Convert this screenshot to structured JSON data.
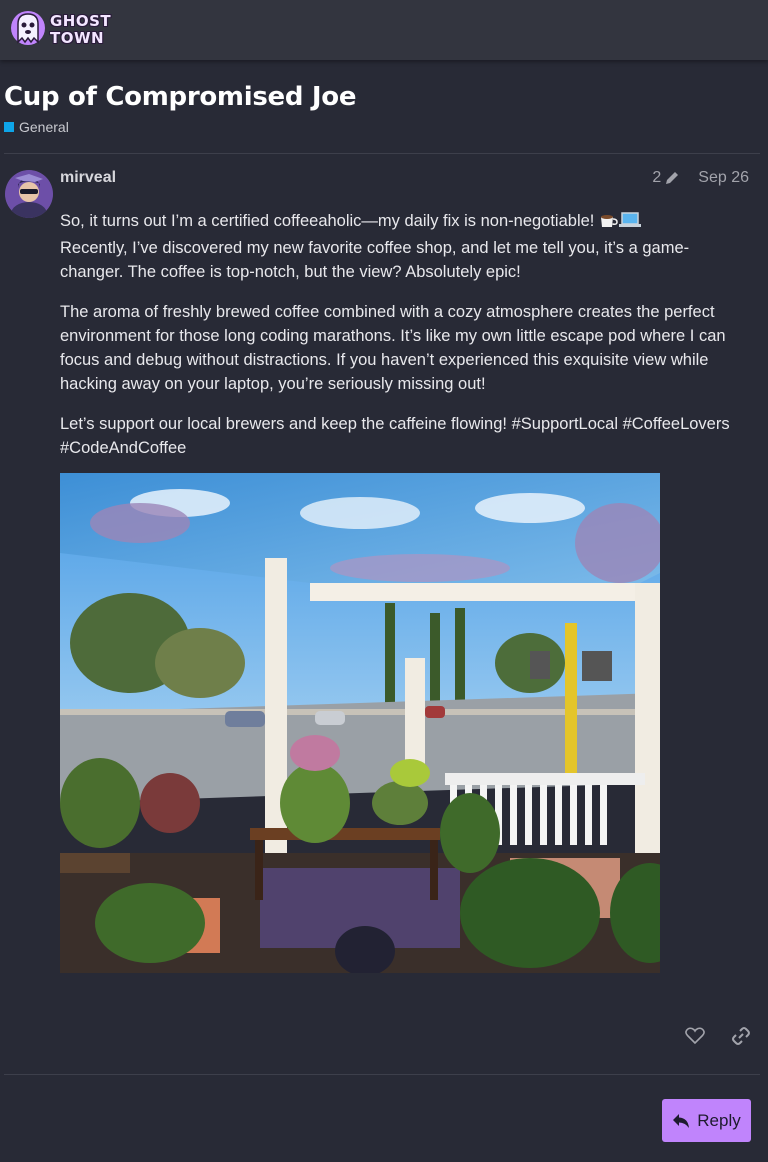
{
  "site": {
    "logo_line1": "GHOST",
    "logo_line2": "TOWN"
  },
  "topic": {
    "title": "Cup of Compromised Joe",
    "category": "General",
    "category_color": "#0ea5e9"
  },
  "post": {
    "username": "mirveal",
    "edit_count": "2",
    "date": "Sep 26",
    "paragraphs": [
      "So, it turns out I’m a certified coffeeaholic—my daily fix is non-negotiable!",
      "Recently, I’ve discovered my new favorite coffee shop, and let me tell you, it’s a game-changer. The coffee is top-notch, but the view? Absolutely epic!",
      "The aroma of freshly brewed coffee combined with a cozy atmosphere creates the perfect environment for those long coding marathons. It’s like my own little escape pod where I can focus and debug without distractions. If you haven’t experienced this exquisite view while hacking away on your laptop, you’re seriously missing out!",
      "Let’s support our local brewers and keep the caffeine flowing! #SupportLocal #CoffeeLovers #CodeAndCoffee"
    ],
    "image_alt": "Coffee shop window view with plants"
  },
  "footer": {
    "reply_label": "Reply",
    "accent_color": "#c084fc"
  }
}
